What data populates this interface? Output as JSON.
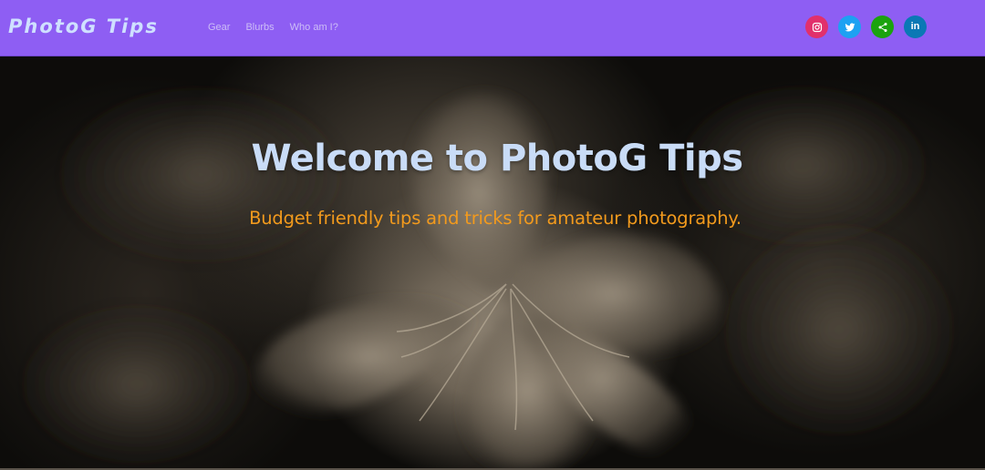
{
  "navbar": {
    "brand": "PhotoG Tips",
    "links": [
      "Gear",
      "Blurbs",
      "Who am I?"
    ],
    "socials": [
      {
        "name": "instagram",
        "icon": "instagram-icon",
        "color": "#e1306c"
      },
      {
        "name": "twitter",
        "icon": "twitter-icon",
        "color": "#1da1f2"
      },
      {
        "name": "share",
        "icon": "share-icon",
        "color": "#1ba30e"
      },
      {
        "name": "linkedin",
        "icon": "linkedin-icon",
        "color": "#0a78b5",
        "text": "in"
      }
    ],
    "background_color": "#8e5ef3"
  },
  "hero": {
    "title": "Welcome to PhotoG Tips",
    "subtitle": "Budget friendly tips and tricks for amateur photography.",
    "title_color": "#c9dcf7",
    "subtitle_color": "#f29a1d",
    "background_image": "sepia-flower-photo"
  }
}
